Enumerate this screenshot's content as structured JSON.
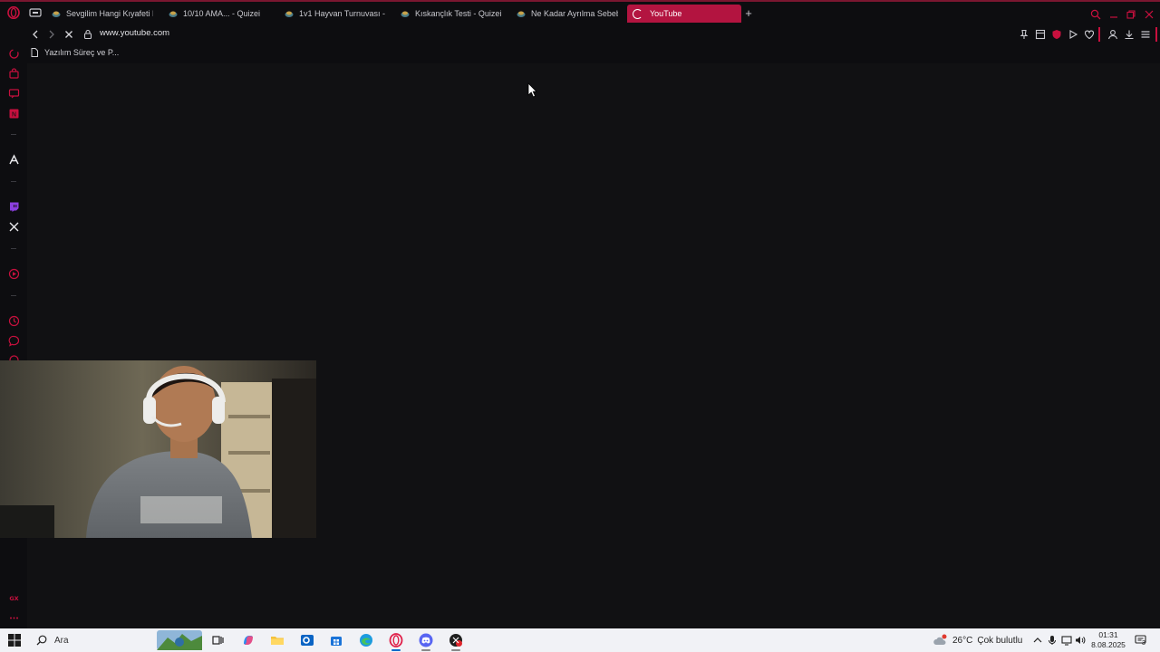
{
  "browser": {
    "tabs": [
      {
        "title": "Sevgilim Hangi Kıyafeti Di"
      },
      {
        "title": "10/10 AMA... - Quizei"
      },
      {
        "title": "1v1 Hayvan Turnuvası - Q"
      },
      {
        "title": "Kıskançlık Testi - Quizei"
      },
      {
        "title": "Ne Kadar Ayrılma Sebebi"
      },
      {
        "title": "YouTube"
      }
    ],
    "active_tab_index": 5,
    "url": "www.youtube.com",
    "bookmarks": [
      {
        "label": "Yazılım Süreç ve P..."
      }
    ],
    "colors": {
      "accent": "#b31440",
      "background": "#111113",
      "chrome": "#0d0d10"
    }
  },
  "sidebar": {
    "icons": [
      "aria-icon",
      "shopping-icon",
      "chat-icon",
      "news-icon",
      "appstore-icon",
      "twitch-icon",
      "x-twitter-icon",
      "player-icon",
      "history-icon",
      "messenger-icon",
      "settings-icon",
      "more-icon"
    ]
  },
  "taskbar": {
    "search_placeholder": "Ara",
    "apps": [
      "task-view-icon",
      "copilot-icon",
      "file-explorer-icon",
      "outlook-icon",
      "store-icon",
      "edge-icon",
      "opera-gx-icon",
      "discord-icon",
      "app-icon"
    ],
    "weather": {
      "temp": "26°C",
      "condition": "Çok bulutlu"
    },
    "time": "01:31",
    "date": "8.08.2025",
    "notification_count": "3"
  }
}
